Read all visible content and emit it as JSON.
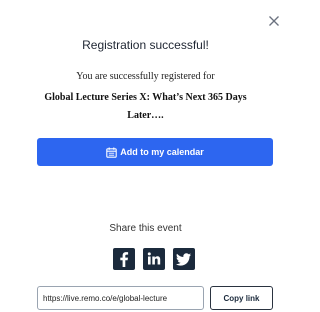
{
  "modal": {
    "title": "Registration successful!",
    "subtitle": "You are successfully registered for",
    "event_name": "Global Lecture Series X: What’s Next 365 Days Later….",
    "calendar_button_label": "Add to my calendar",
    "share_label": "Share this event",
    "share_link_value": "https://live.remo.co/e/global-lecture",
    "copy_button_label": "Copy link",
    "icons": {
      "close": "close-icon",
      "calendar": "calendar-icon",
      "facebook": "facebook-icon",
      "linkedin": "linkedin-icon",
      "twitter": "twitter-icon"
    },
    "colors": {
      "primary": "#2d66f0",
      "social_icon": "#1b2a3c",
      "title_text": "#1f2633"
    }
  }
}
